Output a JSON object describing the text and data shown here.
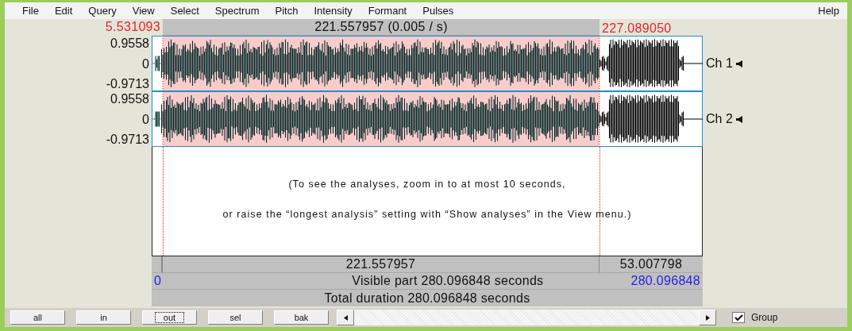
{
  "menu": [
    "File",
    "Edit",
    "Query",
    "View",
    "Select",
    "Spectrum",
    "Pitch",
    "Intensity",
    "Formant",
    "Pulses"
  ],
  "help": "Help",
  "time_bar": {
    "window_start": "5.531093",
    "selection": "221.557957 (0.005 / s)",
    "selection_end": "227.089050"
  },
  "channels": [
    {
      "label": "Ch 1",
      "max": "0.9558",
      "zero": "0",
      "min": "-0.9713"
    },
    {
      "label": "Ch 2",
      "max": "0.9558",
      "zero": "0",
      "min": "-0.9713"
    }
  ],
  "analysis_message": [
    "(To see the analyses, zoom in to at most 10 seconds,",
    "or raise the “longest analysis” setting with “Show analyses” in the View menu.)"
  ],
  "durations": {
    "selection": "221.557957",
    "after_selection": "53.007798"
  },
  "visible": {
    "start": "0",
    "label": "Visible part 280.096848 seconds",
    "end": "280.096848"
  },
  "total": "Total duration 280.096848 seconds",
  "buttons": [
    {
      "label": "all",
      "focused": false
    },
    {
      "label": "in",
      "focused": false
    },
    {
      "label": "out",
      "focused": true
    },
    {
      "label": "sel",
      "focused": false
    },
    {
      "label": "bak",
      "focused": false
    }
  ],
  "group": {
    "label": "Group",
    "checked": true
  }
}
